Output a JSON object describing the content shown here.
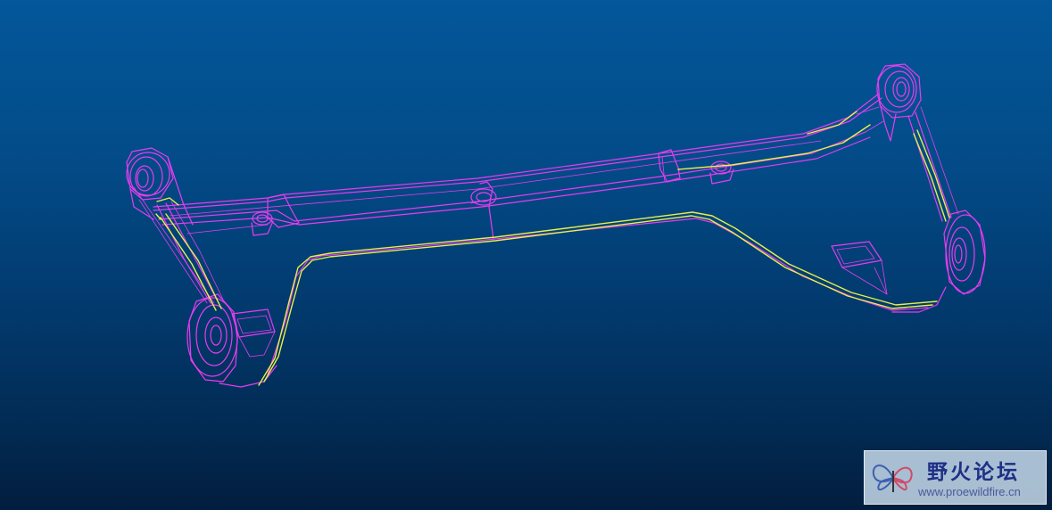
{
  "viewport": {
    "background_top": "#03579a",
    "background_bottom": "#021d3e",
    "primary_edge_color": "#e63cf0",
    "highlight_edge_color": "#e8f04a"
  },
  "watermark": {
    "title": "野火论坛",
    "url": "www.proewildfire.cn",
    "logo_icon": "butterfly-logo-icon"
  }
}
